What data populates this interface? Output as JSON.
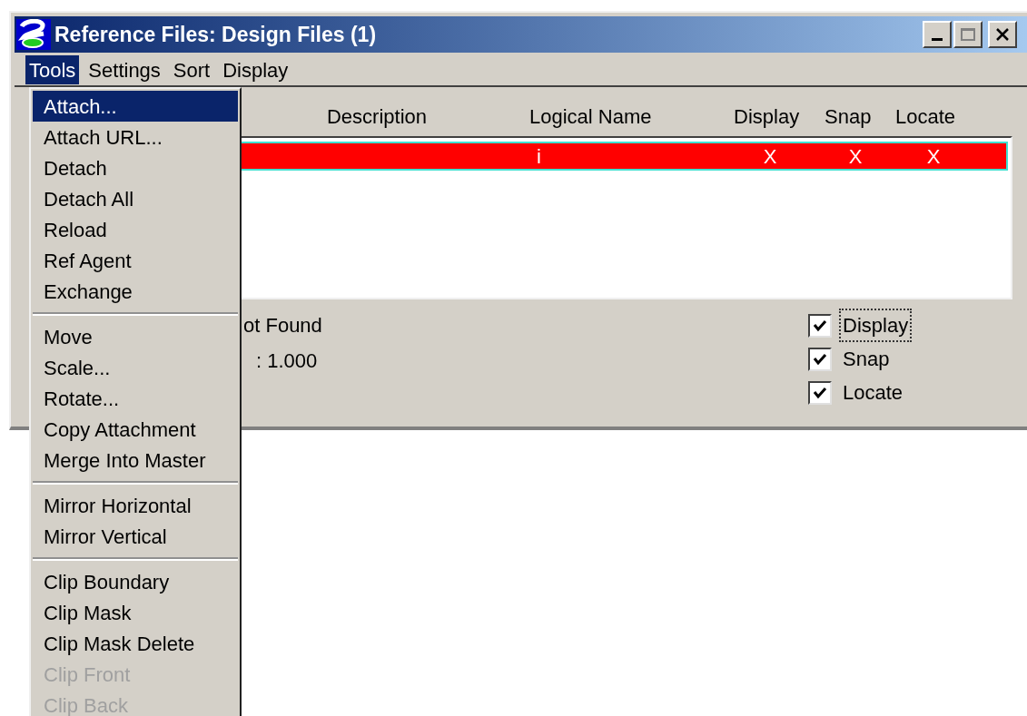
{
  "window": {
    "title": "Reference Files: Design Files (1)"
  },
  "menubar": [
    {
      "label": "Tools",
      "selected": true
    },
    {
      "label": "Settings",
      "selected": false
    },
    {
      "label": "Sort",
      "selected": false
    },
    {
      "label": "Display",
      "selected": false
    }
  ],
  "table": {
    "columns": [
      "Description",
      "Logical Name",
      "Display",
      "Snap",
      "Locate"
    ],
    "rows": [
      {
        "selected": true,
        "cells": [
          "",
          "i",
          "X",
          "X",
          "X"
        ]
      }
    ]
  },
  "details": [
    "ot Found",
    ": 1.000"
  ],
  "checkboxes": [
    {
      "label": "Display",
      "checked": true,
      "focused": true
    },
    {
      "label": "Snap",
      "checked": true,
      "focused": false
    },
    {
      "label": "Locate",
      "checked": true,
      "focused": false
    }
  ],
  "menu": {
    "groups": [
      [
        {
          "label": "Attach...",
          "selected": true,
          "disabled": false
        },
        {
          "label": "Attach URL...",
          "selected": false,
          "disabled": false
        },
        {
          "label": "Detach",
          "selected": false,
          "disabled": false
        },
        {
          "label": "Detach All",
          "selected": false,
          "disabled": false
        },
        {
          "label": "Reload",
          "selected": false,
          "disabled": false
        },
        {
          "label": "Ref Agent",
          "selected": false,
          "disabled": false
        },
        {
          "label": "Exchange",
          "selected": false,
          "disabled": false
        }
      ],
      [
        {
          "label": "Move",
          "selected": false,
          "disabled": false
        },
        {
          "label": "Scale...",
          "selected": false,
          "disabled": false
        },
        {
          "label": "Rotate...",
          "selected": false,
          "disabled": false
        },
        {
          "label": "Copy Attachment",
          "selected": false,
          "disabled": false
        },
        {
          "label": "Merge Into Master",
          "selected": false,
          "disabled": false
        }
      ],
      [
        {
          "label": "Mirror Horizontal",
          "selected": false,
          "disabled": false
        },
        {
          "label": "Mirror Vertical",
          "selected": false,
          "disabled": false
        }
      ],
      [
        {
          "label": "Clip Boundary",
          "selected": false,
          "disabled": false
        },
        {
          "label": "Clip Mask",
          "selected": false,
          "disabled": false
        },
        {
          "label": "Clip Mask Delete",
          "selected": false,
          "disabled": false
        },
        {
          "label": "Clip Front",
          "selected": false,
          "disabled": true
        },
        {
          "label": "Clip Back",
          "selected": false,
          "disabled": true
        }
      ]
    ]
  }
}
